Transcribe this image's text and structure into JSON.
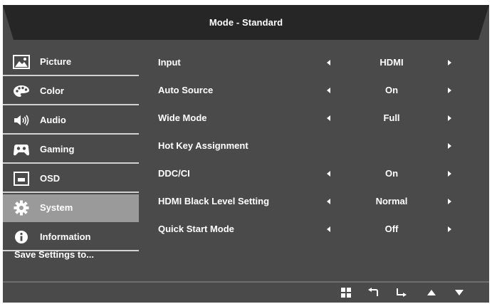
{
  "header": {
    "title": "Mode - Standard"
  },
  "sidebar": {
    "items": [
      {
        "label": "Picture",
        "icon": "picture-icon"
      },
      {
        "label": "Color",
        "icon": "color-palette-icon"
      },
      {
        "label": "Audio",
        "icon": "speaker-icon"
      },
      {
        "label": "Gaming",
        "icon": "gamepad-icon"
      },
      {
        "label": "OSD",
        "icon": "osd-icon"
      },
      {
        "label": "System",
        "icon": "gear-icon",
        "selected": true
      },
      {
        "label": "Information",
        "icon": "info-icon"
      }
    ],
    "save_label": "Save Settings to..."
  },
  "settings": {
    "rows": [
      {
        "label": "Input",
        "value": "HDMI"
      },
      {
        "label": "Auto Source",
        "value": "On"
      },
      {
        "label": "Wide Mode",
        "value": "Full"
      },
      {
        "label": "Hot Key Assignment",
        "value": ""
      },
      {
        "label": "DDC/CI",
        "value": "On"
      },
      {
        "label": "HDMI Black Level Setting",
        "value": "Normal"
      },
      {
        "label": "Quick Start Mode",
        "value": "Off"
      }
    ]
  },
  "footer": {
    "buttons": [
      "menu-grid-icon",
      "back-icon",
      "enter-icon",
      "up-arrow-icon",
      "down-arrow-icon"
    ]
  },
  "colors": {
    "panel": "#4a4a4a",
    "header": "#262626",
    "selected": "#9a9a9a",
    "divider": "#d2d2d2"
  }
}
